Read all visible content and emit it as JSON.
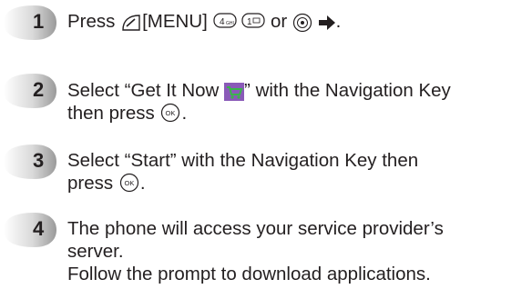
{
  "steps": [
    {
      "num": "1",
      "line1_a": "Press",
      "line1_b": "[MENU]",
      "line1_c": "or",
      "line1_d": "."
    },
    {
      "num": "2",
      "line1_a": "Select “Get It Now",
      "line1_b": "” with the Navigation Key",
      "line2_a": "then press",
      "line2_b": "."
    },
    {
      "num": "3",
      "line1": "Select “Start” with the Navigation Key then",
      "line2_a": "press",
      "line2_b": "."
    },
    {
      "num": "4",
      "line1": "The phone will access your service provider’s",
      "line2": "server.",
      "line3": "Follow the prompt to download applications."
    }
  ],
  "keys": {
    "four_key_label": "4",
    "four_key_sub": "GHI",
    "one_key_label": "1",
    "ok_label": "OK"
  },
  "colors": {
    "badge_light": "#f2f2f2",
    "badge_dark": "#9a9a9a",
    "text": "#231f20",
    "cart_bg": "#8a5ab8",
    "cart_green": "#39b54a"
  }
}
